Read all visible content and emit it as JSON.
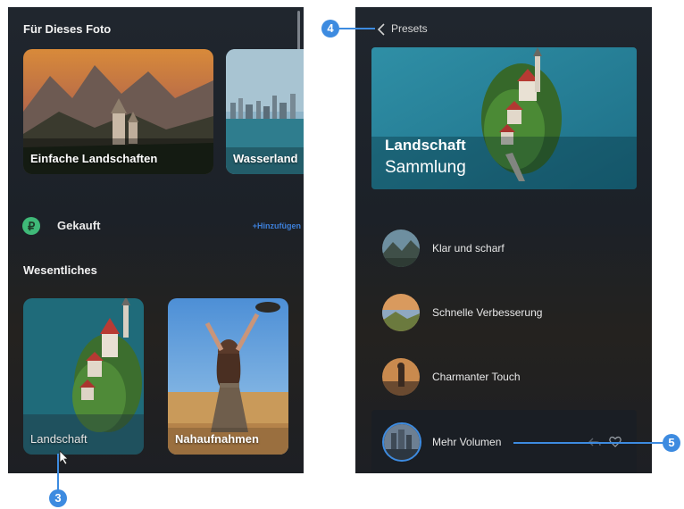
{
  "left": {
    "section_photo": "Für Dieses Foto",
    "cards_top": [
      {
        "label": "Einfache Landschaften"
      },
      {
        "label": "Wasserland"
      }
    ],
    "bought_label": "Gekauft",
    "add_label": "+Hinzufügen",
    "section_essentials": "Wesentliches",
    "cards_bottom": [
      {
        "label": "Landschaft"
      },
      {
        "label": "Nahaufnahmen"
      }
    ]
  },
  "right": {
    "back_label": "Presets",
    "hero_title": "Landschaft",
    "hero_subtitle": "Sammlung",
    "items": [
      {
        "label": "Klar und scharf"
      },
      {
        "label": "Schnelle Verbesserung"
      },
      {
        "label": "Charmanter Touch"
      },
      {
        "label": "Mehr Volumen"
      }
    ]
  },
  "callouts": [
    "3",
    "4",
    "5"
  ],
  "colors": {
    "accent": "#3d8be0",
    "bought_icon": "#3fb978",
    "link": "#3d7fd9"
  }
}
